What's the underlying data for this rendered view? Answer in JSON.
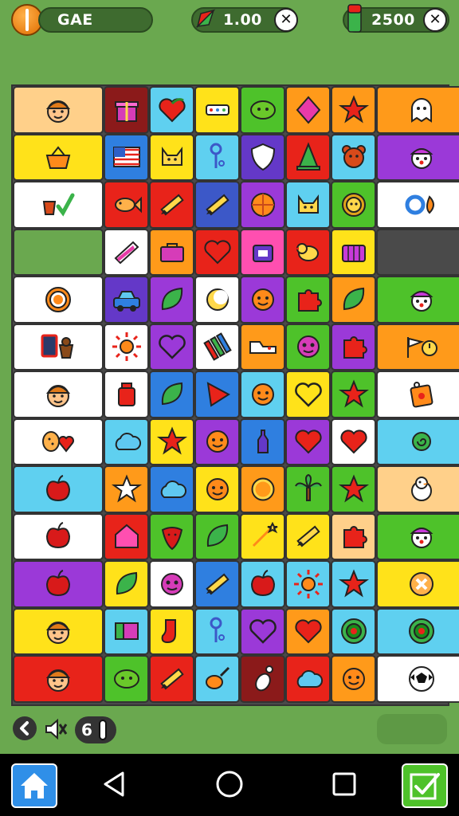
{
  "top_bar": {
    "title": "GAE",
    "moves_value": "1.00",
    "score_value": "2500"
  },
  "footer": {
    "counter": "6"
  },
  "palette": {
    "peach": "#ffd08a",
    "maroon": "#8b1a1a",
    "sky": "#5fd0f0",
    "yellow": "#ffe21a",
    "green": "#4ec22a",
    "orange": "#ff9a1a",
    "white": "#ffffff",
    "blue": "#2f7fe0",
    "purple": "#9b39d8",
    "red": "#e8231a",
    "pink": "#ff4fb0",
    "grass": "#6aa84f",
    "dark": "#4a4a4a",
    "navy": "#3c58c8",
    "indigo": "#6438c8"
  },
  "rows": [
    {
      "tiles": [
        {
          "w": 2,
          "color": "peach",
          "icon": "boy-face-icon"
        },
        {
          "w": 1,
          "color": "maroon",
          "icon": "gift-icon"
        },
        {
          "w": 1,
          "color": "sky",
          "icon": "heart-leaf-icon"
        },
        {
          "w": 1,
          "color": "yellow",
          "icon": "pencil-case-icon"
        },
        {
          "w": 1,
          "color": "green",
          "icon": "blob-face-icon"
        },
        {
          "w": 1,
          "color": "orange",
          "icon": "diamond-icon"
        },
        {
          "w": 1,
          "color": "orange",
          "icon": "star-icon"
        },
        {
          "w": 2,
          "color": "orange",
          "icon": "ghost-icon"
        }
      ]
    },
    {
      "tiles": [
        {
          "w": 2,
          "color": "yellow",
          "icon": "basket-icon"
        },
        {
          "w": 1,
          "color": "blue",
          "icon": "flag-icon"
        },
        {
          "w": 1,
          "color": "yellow",
          "icon": "cat-face-icon"
        },
        {
          "w": 1,
          "color": "sky",
          "icon": "key-icon"
        },
        {
          "w": 1,
          "color": "indigo",
          "icon": "shield-icon"
        },
        {
          "w": 1,
          "color": "red",
          "icon": "cone-icon"
        },
        {
          "w": 1,
          "color": "sky",
          "icon": "bear-face-icon"
        },
        {
          "w": 2,
          "color": "purple",
          "icon": "clown-face-icon"
        }
      ]
    },
    {
      "tiles": [
        {
          "w": 2,
          "color": "white",
          "icon": "pot-and-check-icon"
        },
        {
          "w": 1,
          "color": "red",
          "icon": "fish-icon"
        },
        {
          "w": 1,
          "color": "red",
          "icon": "pencil-icon"
        },
        {
          "w": 1,
          "color": "navy",
          "icon": "pencil-icon"
        },
        {
          "w": 1,
          "color": "purple",
          "icon": "ball-icon"
        },
        {
          "w": 1,
          "color": "sky",
          "icon": "cat-face-icon"
        },
        {
          "w": 1,
          "color": "green",
          "icon": "lion-face-icon"
        },
        {
          "w": 2,
          "color": "white",
          "icon": "ring-and-bean-icon"
        }
      ]
    },
    {
      "tiles": [
        {
          "w": 2,
          "color": "grass",
          "icon": "none"
        },
        {
          "w": 1,
          "color": "white",
          "icon": "notebook-icon"
        },
        {
          "w": 1,
          "color": "orange",
          "icon": "toolbox-icon"
        },
        {
          "w": 1,
          "color": "red",
          "icon": "heart-icon"
        },
        {
          "w": 1,
          "color": "pink",
          "icon": "bag-icon"
        },
        {
          "w": 1,
          "color": "red",
          "icon": "bird-icon"
        },
        {
          "w": 1,
          "color": "yellow",
          "icon": "crate-icon"
        },
        {
          "w": 2,
          "color": "dark",
          "icon": "none"
        }
      ]
    },
    {
      "tiles": [
        {
          "w": 2,
          "color": "white",
          "icon": "cookie-icon"
        },
        {
          "w": 1,
          "color": "indigo",
          "icon": "car-icon"
        },
        {
          "w": 1,
          "color": "purple",
          "icon": "leaf-icon"
        },
        {
          "w": 1,
          "color": "white",
          "icon": "moon-icon"
        },
        {
          "w": 1,
          "color": "purple",
          "icon": "smile-face-icon"
        },
        {
          "w": 1,
          "color": "green",
          "icon": "puzzle-icon"
        },
        {
          "w": 1,
          "color": "orange",
          "icon": "leaf-icon"
        },
        {
          "w": 2,
          "color": "green",
          "icon": "clown-face-icon"
        }
      ]
    },
    {
      "tiles": [
        {
          "w": 2,
          "color": "white",
          "icon": "frame-and-pot-icon"
        },
        {
          "w": 1,
          "color": "white",
          "icon": "sun-icon"
        },
        {
          "w": 1,
          "color": "purple",
          "icon": "heart-outline-icon"
        },
        {
          "w": 1,
          "color": "white",
          "icon": "crayons-icon"
        },
        {
          "w": 1,
          "color": "orange",
          "icon": "shoe-icon"
        },
        {
          "w": 1,
          "color": "green",
          "icon": "monster-face-icon"
        },
        {
          "w": 1,
          "color": "purple",
          "icon": "puzzle-icon"
        },
        {
          "w": 2,
          "color": "orange",
          "icon": "flag-and-clock-icon"
        }
      ]
    },
    {
      "tiles": [
        {
          "w": 2,
          "color": "white",
          "icon": "boy-face-icon"
        },
        {
          "w": 1,
          "color": "white",
          "icon": "jar-icon"
        },
        {
          "w": 1,
          "color": "blue",
          "icon": "leaf-icon"
        },
        {
          "w": 1,
          "color": "blue",
          "icon": "triangle-icon"
        },
        {
          "w": 1,
          "color": "sky",
          "icon": "smile-face-icon"
        },
        {
          "w": 1,
          "color": "yellow",
          "icon": "heart-outline-icon"
        },
        {
          "w": 1,
          "color": "green",
          "icon": "star-icon"
        },
        {
          "w": 2,
          "color": "white",
          "icon": "tag-icon"
        }
      ]
    },
    {
      "tiles": [
        {
          "w": 2,
          "color": "white",
          "icon": "cookie-and-heart-icon"
        },
        {
          "w": 1,
          "color": "sky",
          "icon": "cloud-icon"
        },
        {
          "w": 1,
          "color": "yellow",
          "icon": "star-icon"
        },
        {
          "w": 1,
          "color": "purple",
          "icon": "smile-face-icon"
        },
        {
          "w": 1,
          "color": "blue",
          "icon": "bottle-icon"
        },
        {
          "w": 1,
          "color": "purple",
          "icon": "heart-icon"
        },
        {
          "w": 1,
          "color": "white",
          "icon": "heart-icon"
        },
        {
          "w": 2,
          "color": "sky",
          "icon": "snail-icon"
        }
      ]
    },
    {
      "tiles": [
        {
          "w": 2,
          "color": "sky",
          "icon": "apple-icon"
        },
        {
          "w": 1,
          "color": "orange",
          "icon": "star-outline-icon"
        },
        {
          "w": 1,
          "color": "blue",
          "icon": "cloud-icon"
        },
        {
          "w": 1,
          "color": "yellow",
          "icon": "smile-face-icon"
        },
        {
          "w": 1,
          "color": "orange",
          "icon": "ring-icon"
        },
        {
          "w": 1,
          "color": "green",
          "icon": "palm-tree-icon"
        },
        {
          "w": 1,
          "color": "green",
          "icon": "star-icon"
        },
        {
          "w": 2,
          "color": "peach",
          "icon": "chick-icon"
        }
      ]
    },
    {
      "tiles": [
        {
          "w": 2,
          "color": "white",
          "icon": "apple-icon"
        },
        {
          "w": 1,
          "color": "red",
          "icon": "house-icon"
        },
        {
          "w": 1,
          "color": "green",
          "icon": "strawberry-icon"
        },
        {
          "w": 1,
          "color": "green",
          "icon": "leaf-icon"
        },
        {
          "w": 1,
          "color": "yellow",
          "icon": "wand-icon"
        },
        {
          "w": 1,
          "color": "yellow",
          "icon": "pencil-icon"
        },
        {
          "w": 1,
          "color": "peach",
          "icon": "puzzle-icon"
        },
        {
          "w": 2,
          "color": "green",
          "icon": "clown-face-icon"
        }
      ]
    },
    {
      "tiles": [
        {
          "w": 2,
          "color": "purple",
          "icon": "apple-icon"
        },
        {
          "w": 1,
          "color": "yellow",
          "icon": "leaf-icon"
        },
        {
          "w": 1,
          "color": "white",
          "icon": "monster-face-icon"
        },
        {
          "w": 1,
          "color": "blue",
          "icon": "pencil-icon"
        },
        {
          "w": 1,
          "color": "sky",
          "icon": "apple-icon"
        },
        {
          "w": 1,
          "color": "sky",
          "icon": "sun-icon"
        },
        {
          "w": 1,
          "color": "sky",
          "icon": "star-icon"
        },
        {
          "w": 2,
          "color": "yellow",
          "icon": "pretzel-icon"
        }
      ]
    },
    {
      "tiles": [
        {
          "w": 2,
          "color": "yellow",
          "icon": "boy-face-icon"
        },
        {
          "w": 1,
          "color": "sky",
          "icon": "book-icon"
        },
        {
          "w": 1,
          "color": "yellow",
          "icon": "sock-icon"
        },
        {
          "w": 1,
          "color": "sky",
          "icon": "key-icon"
        },
        {
          "w": 1,
          "color": "purple",
          "icon": "heart-outline-icon"
        },
        {
          "w": 1,
          "color": "orange",
          "icon": "heart-icon"
        },
        {
          "w": 1,
          "color": "sky",
          "icon": "target-icon"
        },
        {
          "w": 2,
          "color": "sky",
          "icon": "target-icon"
        }
      ]
    },
    {
      "tiles": [
        {
          "w": 2,
          "color": "red",
          "icon": "boy-face-icon"
        },
        {
          "w": 1,
          "color": "green",
          "icon": "blob-face-icon"
        },
        {
          "w": 1,
          "color": "red",
          "icon": "pencil-icon"
        },
        {
          "w": 1,
          "color": "sky",
          "icon": "drumstick-icon"
        },
        {
          "w": 1,
          "color": "maroon",
          "icon": "bone-icon"
        },
        {
          "w": 1,
          "color": "red",
          "icon": "cloud-icon"
        },
        {
          "w": 1,
          "color": "orange",
          "icon": "smile-face-icon"
        },
        {
          "w": 2,
          "color": "white",
          "icon": "soccer-ball-icon"
        }
      ]
    }
  ]
}
